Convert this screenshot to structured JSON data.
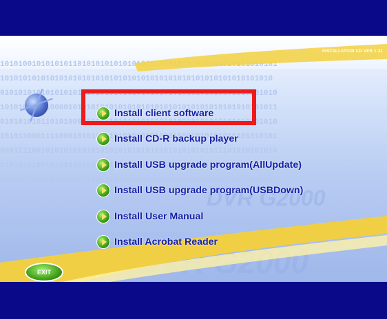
{
  "header": {
    "version_label": "INSTALLATION CD VER 1.21"
  },
  "background": {
    "binary_rows": [
      "1010100101010101101010101010101010101010101010101010101010101",
      "101010101010101010101010101010101010101010101010101010101010",
      "0101010101010101010101010101010101010101010101010101010101010",
      "1010101010100001010101010101010101010101010101010101010101011",
      "0101010101101010000011111010101010101010010101010101010101010",
      "1010110001111000101010101010101010100010001010101010101010101",
      "0001111001010101010101010101010101010101010101011101010101010",
      "0101010100101010101010101010101010101010101001010101010101010",
      "1010101010101010100110101010101010101010101010101010101010101"
    ],
    "watermark_text": "DVR G2000"
  },
  "menu": {
    "items": [
      {
        "label": "Install client software"
      },
      {
        "label": "Install CD-R backup player"
      },
      {
        "label": "Install USB upgrade program(AllUpdate)"
      },
      {
        "label": "Install USB upgrade program(USBDown)"
      },
      {
        "label": "Install User Manual"
      },
      {
        "label": "Install Acrobat Reader"
      }
    ]
  },
  "exit_button": {
    "label": "EXIT"
  },
  "colors": {
    "highlight": "#ee1b1b",
    "menu_text": "#141fa6",
    "band_blue": "#09098a",
    "icon_green": "#3aa018"
  }
}
